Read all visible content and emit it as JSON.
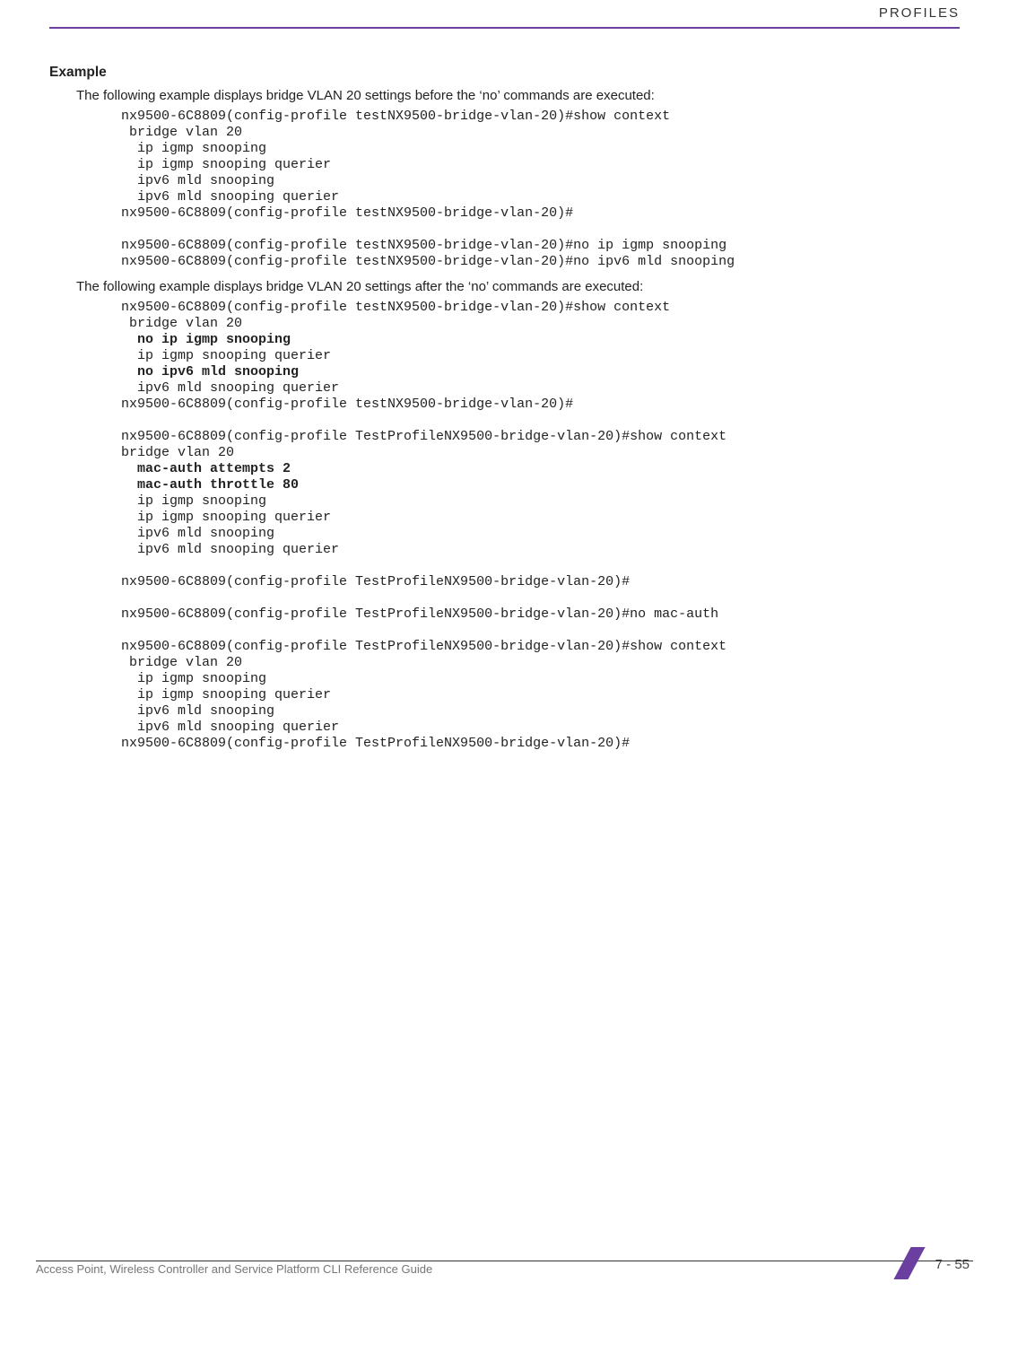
{
  "header": {
    "right": "PROFILES"
  },
  "example_heading": "Example",
  "intro_before": "The following example displays bridge VLAN 20 settings before the ‘no’ commands are executed:",
  "code1": "nx9500-6C8809(config-profile testNX9500-bridge-vlan-20)#show context\n bridge vlan 20\n  ip igmp snooping\n  ip igmp snooping querier\n  ipv6 mld snooping\n  ipv6 mld snooping querier\nnx9500-6C8809(config-profile testNX9500-bridge-vlan-20)#\n\nnx9500-6C8809(config-profile testNX9500-bridge-vlan-20)#no ip igmp snooping\nnx9500-6C8809(config-profile testNX9500-bridge-vlan-20)#no ipv6 mld snooping",
  "intro_after": "The following example displays bridge VLAN 20 settings after the ‘no’ commands are executed:",
  "code2_a": "nx9500-6C8809(config-profile testNX9500-bridge-vlan-20)#show context\n bridge vlan 20",
  "code2_b1": "  no ip igmp snooping",
  "code2_c": "  ip igmp snooping querier",
  "code2_b2": "  no ipv6 mld snooping",
  "code2_d": "  ipv6 mld snooping querier\nnx9500-6C8809(config-profile testNX9500-bridge-vlan-20)#",
  "code3_a": "nx9500-6C8809(config-profile TestProfileNX9500-bridge-vlan-20)#show context\nbridge vlan 20",
  "code3_b1": "  mac-auth attempts 2",
  "code3_b2": "  mac-auth throttle 80",
  "code3_c": "  ip igmp snooping\n  ip igmp snooping querier\n  ipv6 mld snooping\n  ipv6 mld snooping querier\n\nnx9500-6C8809(config-profile TestProfileNX9500-bridge-vlan-20)#\n\nnx9500-6C8809(config-profile TestProfileNX9500-bridge-vlan-20)#no mac-auth\n\nnx9500-6C8809(config-profile TestProfileNX9500-bridge-vlan-20)#show context\n bridge vlan 20\n  ip igmp snooping\n  ip igmp snooping querier\n  ipv6 mld snooping\n  ipv6 mld snooping querier\nnx9500-6C8809(config-profile TestProfileNX9500-bridge-vlan-20)#",
  "footer": {
    "left": "Access Point, Wireless Controller and Service Platform CLI Reference Guide",
    "page": "7 - 55"
  }
}
